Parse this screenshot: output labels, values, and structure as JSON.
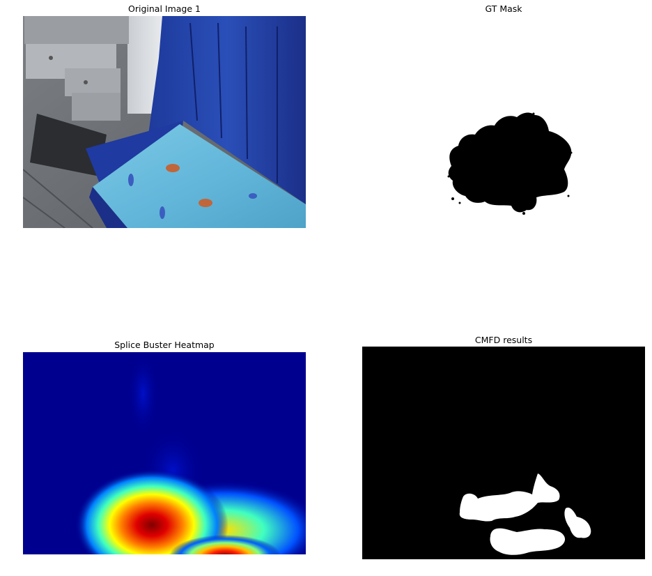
{
  "panels": {
    "original": {
      "title": "Original Image 1"
    },
    "gt_mask": {
      "title": "GT Mask"
    },
    "heatmap": {
      "title": "Splice Buster Heatmap"
    },
    "cmfd": {
      "title": "CMFD results"
    }
  },
  "colors": {
    "background": "#ffffff",
    "mask_foreground": "#000000",
    "cmfd_background": "#000000",
    "cmfd_foreground": "#ffffff",
    "heatmap_low": "#00008f",
    "heatmap_high": "#800000"
  }
}
